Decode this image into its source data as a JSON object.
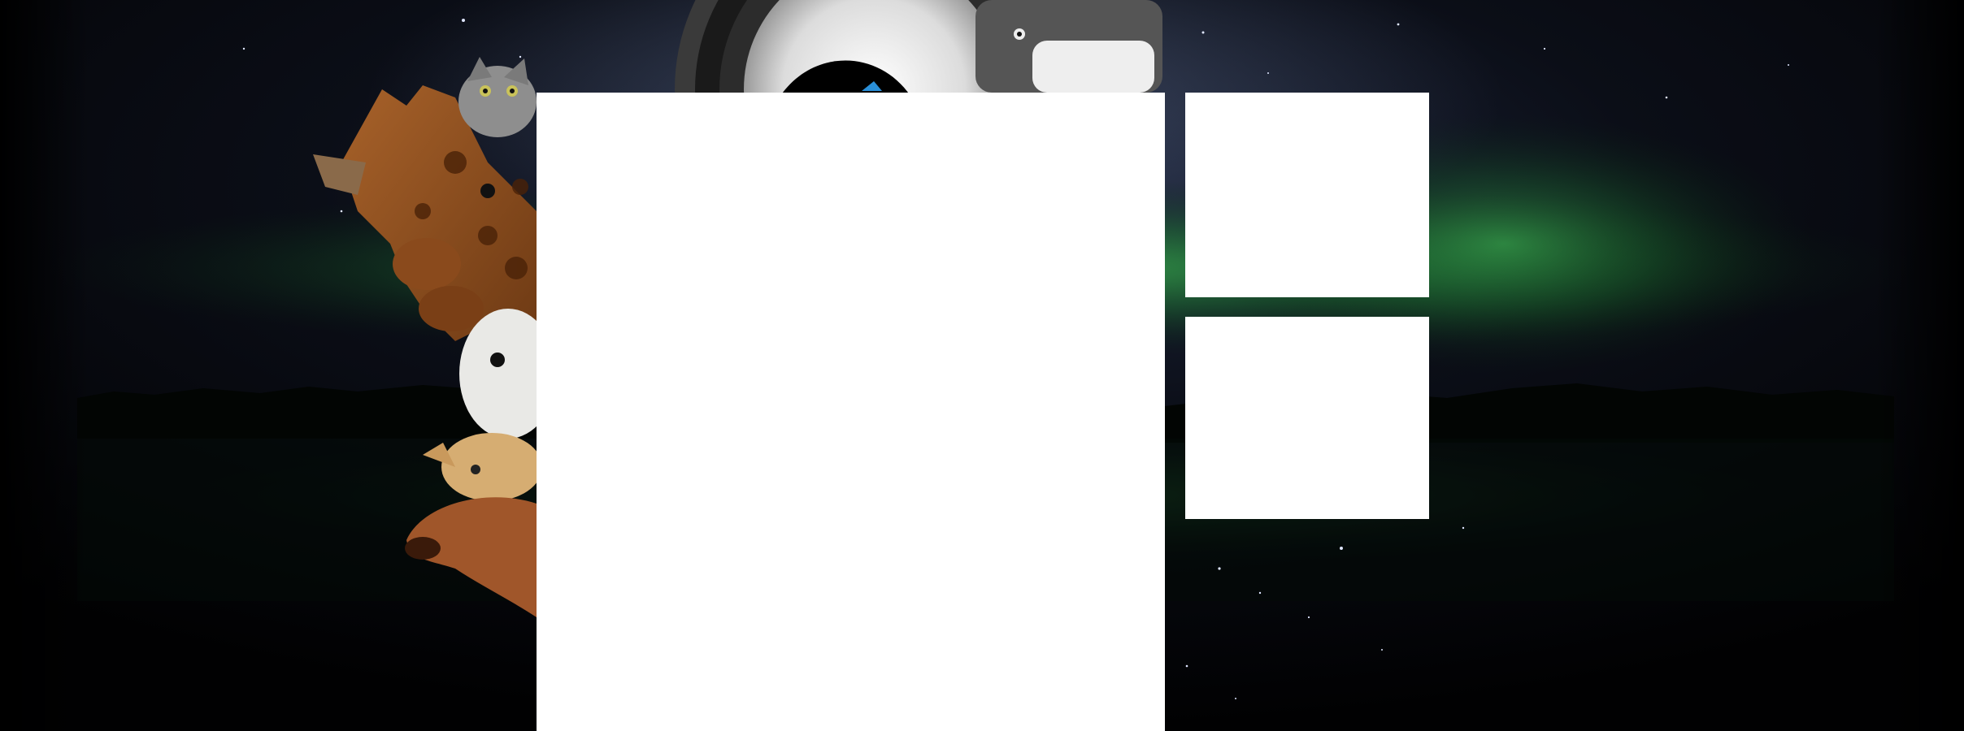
{
  "page": {
    "background": {
      "theme": "night sky with green aurora over a lake and treeline",
      "colors": {
        "sky": "#0b0e17",
        "haze": "#1e2740",
        "aurora": "#2f9e44",
        "edge": "#000000"
      },
      "artwork": [
        "giraffe",
        "tabby-cat",
        "white-seal",
        "orange-kitten",
        "brown-dog",
        "camera-lens"
      ]
    },
    "panels": {
      "main": "",
      "side_top": "",
      "side_bottom": ""
    },
    "panel_color": "#ffffff"
  }
}
